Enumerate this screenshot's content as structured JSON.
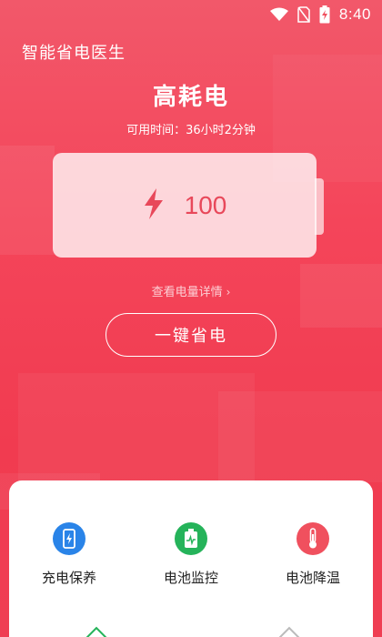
{
  "status_bar": {
    "time": "8:40",
    "icons": [
      "wifi-icon",
      "no-sim-icon",
      "battery-charging-icon"
    ]
  },
  "app": {
    "title": "智能省电医生"
  },
  "main": {
    "headline": "高耗电",
    "available_time": "可用时间：36小时2分钟",
    "battery_level": "100",
    "battery_icon": "lightning-bolt-icon",
    "detail_link": "查看电量详情",
    "detail_chevron": "›",
    "save_button": "一键省电"
  },
  "features": [
    {
      "label": "充电保养",
      "icon": "phone-charge-icon",
      "color": "#2a84e8"
    },
    {
      "label": "电池监控",
      "icon": "battery-monitor-icon",
      "color": "#25b35a"
    },
    {
      "label": "电池降温",
      "icon": "thermometer-icon",
      "color": "#f0505e"
    }
  ],
  "colors": {
    "accent_red": "#f13b50",
    "battery_text": "#e8485a"
  }
}
